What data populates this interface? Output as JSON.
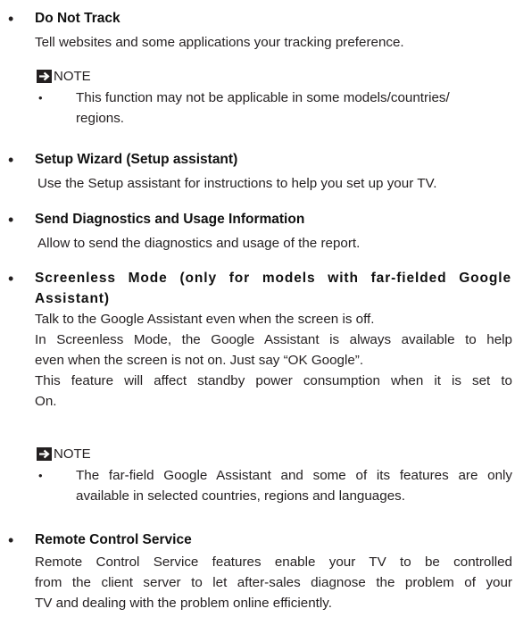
{
  "bullet_char": "•",
  "note_bullet_char": "•",
  "items": [
    {
      "title": "Do Not Track",
      "body_lines": [
        "Tell websites and some applications your tracking preference."
      ],
      "note": {
        "label": "NOTE",
        "icon": "arrow-box-icon",
        "text_lines": [
          "This function may not be applicable in some models/countries/",
          "regions."
        ]
      }
    },
    {
      "title": "Setup Wizard (Setup assistant)",
      "body_lines": [
        "Use the Setup assistant for instructions to help you set up your TV."
      ]
    },
    {
      "title": "Send Diagnostics and Usage Information",
      "body_lines": [
        "Allow to send the diagnostics and usage of the report."
      ]
    },
    {
      "title_lines": [
        "Screenless Mode (only for models with far-fielded Google",
        "Assistant)"
      ],
      "body_lines": [
        "Talk to the Google Assistant even when the screen is off.",
        "In Screenless Mode, the Google Assistant is always available to help",
        "even when the screen is not on. Just say “OK Google”.",
        "This feature will affect standby power consumption when it is set to",
        "On."
      ],
      "note": {
        "label": "NOTE",
        "icon": "arrow-box-icon",
        "text_lines": [
          "The far-field Google Assistant and some of its features are only",
          "available in selected countries, regions and languages."
        ]
      }
    },
    {
      "title": "Remote Control Service",
      "body_lines": [
        "Remote Control Service features enable your TV to be controlled",
        "from the client server to let after-sales diagnose the problem of your",
        "TV and dealing with the problem online efficiently."
      ]
    }
  ]
}
